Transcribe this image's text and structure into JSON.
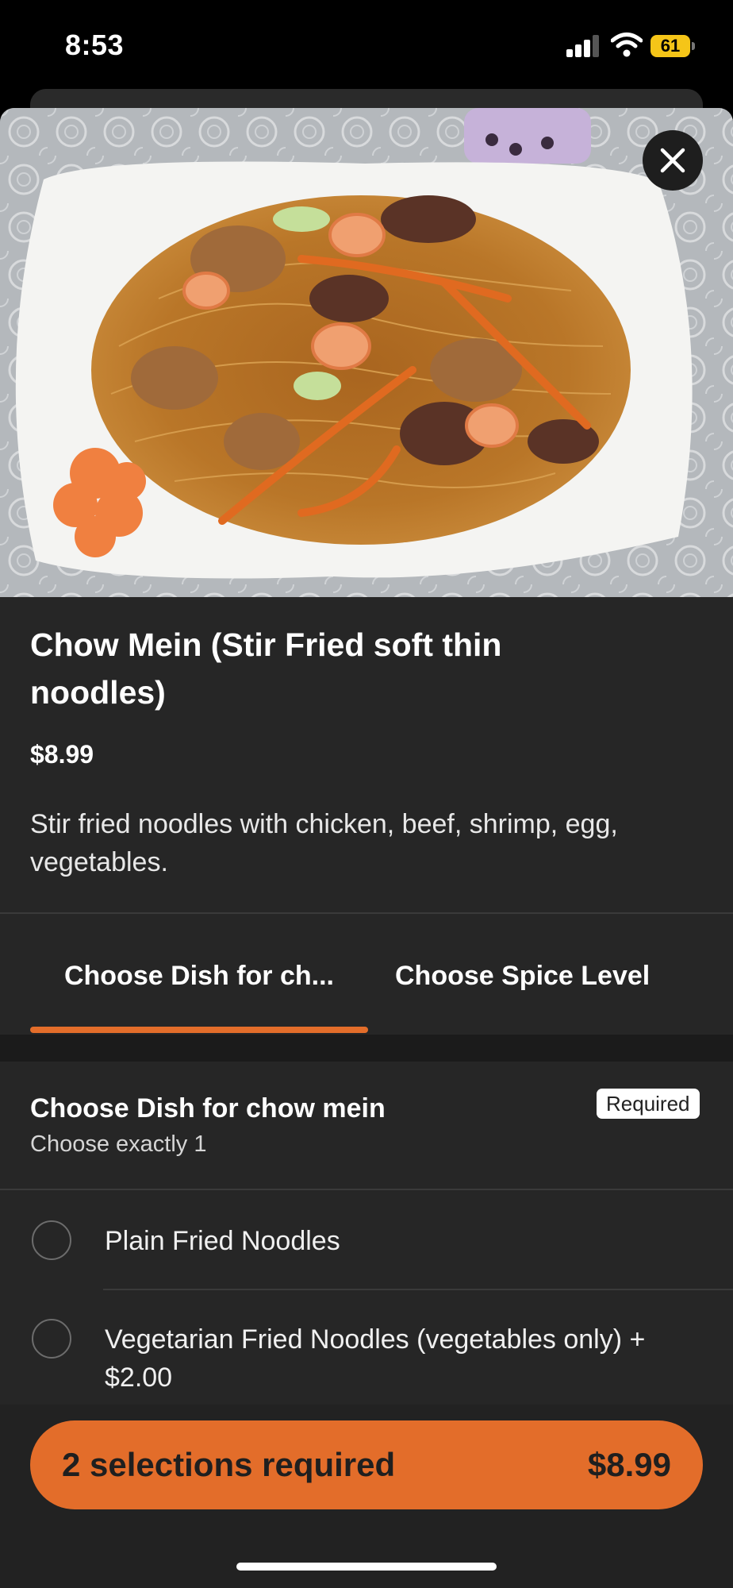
{
  "status": {
    "time": "8:53",
    "battery": "61"
  },
  "item": {
    "title": "Chow Mein (Stir Fried soft thin noodles)",
    "price": "$8.99",
    "description": "Stir fried noodles with chicken, beef, shrimp, egg, vegetables."
  },
  "tabs": [
    {
      "label": "Choose Dish for ch...",
      "active": true
    },
    {
      "label": "Choose Spice Level",
      "active": false
    }
  ],
  "section": {
    "title": "Choose Dish for chow mein",
    "subtitle": "Choose exactly 1",
    "badge": "Required",
    "options": [
      {
        "label": "Plain Fried Noodles"
      },
      {
        "label": "Vegetarian Fried Noodles (vegetables only) + $2.00"
      }
    ]
  },
  "cta": {
    "label": "2 selections required",
    "price": "$8.99"
  },
  "colors": {
    "accent": "#e36d2a",
    "background": "#262626",
    "battery": "#f5c518"
  },
  "icons": [
    "signal-icon",
    "wifi-icon",
    "battery-icon",
    "close-icon",
    "radio-icon"
  ]
}
